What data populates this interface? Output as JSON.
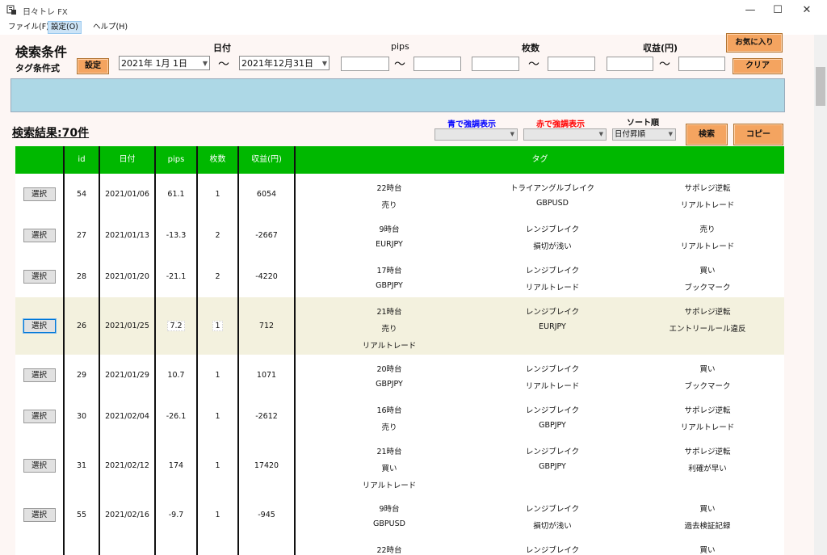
{
  "window": {
    "title": "日々トレ FX",
    "min": "—",
    "max": "☐",
    "close": "✕"
  },
  "menu": [
    "ファイル(F)",
    "設定(O)",
    "ヘルプ(H)"
  ],
  "search": {
    "heading": "検索条件",
    "tag_label": "タグ条件式",
    "settings_btn": "設定",
    "date_label": "日付",
    "pips_label": "pips",
    "lots_label": "枚数",
    "profit_label": "収益(円)",
    "date_from": "2021年  1月  1日",
    "date_to": "2021年12月31日",
    "tilde": "〜",
    "fav_btn": "お気に入り",
    "clear_btn": "クリア"
  },
  "results": {
    "title": "検索結果:70件",
    "blue_label": "青で強調表示",
    "red_label": "赤で強調表示",
    "sort_label": "ソート順",
    "sort_value": "日付昇順",
    "search_btn": "検索",
    "copy_btn": "コピー"
  },
  "colors": {
    "header_green": "#00b800",
    "orange_button": "#f4a460",
    "blue_panel": "#add8e6",
    "highlight_row": "#f3f1de",
    "blue_text": "#0000ff",
    "red_text": "#ff0000"
  },
  "table": {
    "headers": [
      "",
      "id",
      "日付",
      "pips",
      "枚数",
      "収益(円)",
      "タグ"
    ],
    "select_label": "選択",
    "rows": [
      {
        "id": "54",
        "date": "2021/01/06",
        "pips": "61.1",
        "lots": "1",
        "profit": "6054",
        "tags": [
          "22時台",
          "トライアングルブレイク",
          "サポレジ逆転",
          "売り",
          "GBPUSD",
          "リアルトレード"
        ]
      },
      {
        "id": "27",
        "date": "2021/01/13",
        "pips": "-13.3",
        "lots": "2",
        "profit": "-2667",
        "tags": [
          "9時台",
          "レンジブレイク",
          "売り",
          "EURJPY",
          "損切が浅い",
          "リアルトレード"
        ]
      },
      {
        "id": "28",
        "date": "2021/01/20",
        "pips": "-21.1",
        "lots": "2",
        "profit": "-4220",
        "tags": [
          "17時台",
          "レンジブレイク",
          "買い",
          "GBPJPY",
          "リアルトレード",
          "ブックマーク"
        ]
      },
      {
        "id": "26",
        "date": "2021/01/25",
        "pips": "7.2",
        "lots": "1",
        "profit": "712",
        "tags": [
          "21時台",
          "レンジブレイク",
          "サポレジ逆転",
          "売り",
          "EURJPY",
          "エントリールール違反",
          "リアルトレード"
        ]
      },
      {
        "id": "29",
        "date": "2021/01/29",
        "pips": "10.7",
        "lots": "1",
        "profit": "1071",
        "tags": [
          "20時台",
          "レンジブレイク",
          "買い",
          "GBPJPY",
          "リアルトレード",
          "ブックマーク"
        ]
      },
      {
        "id": "30",
        "date": "2021/02/04",
        "pips": "-26.1",
        "lots": "1",
        "profit": "-2612",
        "tags": [
          "16時台",
          "レンジブレイク",
          "サポレジ逆転",
          "売り",
          "GBPJPY",
          "リアルトレード"
        ]
      },
      {
        "id": "31",
        "date": "2021/02/12",
        "pips": "174",
        "lots": "1",
        "profit": "17420",
        "tags": [
          "21時台",
          "レンジブレイク",
          "サポレジ逆転",
          "買い",
          "GBPJPY",
          "利確が早い",
          "リアルトレード"
        ]
      },
      {
        "id": "55",
        "date": "2021/02/16",
        "pips": "-9.7",
        "lots": "1",
        "profit": "-945",
        "tags": [
          "9時台",
          "レンジブレイク",
          "買い",
          "GBPUSD",
          "損切が浅い",
          "過去検証記録"
        ]
      },
      {
        "id": "",
        "date": "",
        "pips": "",
        "lots": "",
        "profit": "",
        "tags": [
          "22時台",
          "レンジブレイク",
          "買い"
        ]
      }
    ]
  }
}
